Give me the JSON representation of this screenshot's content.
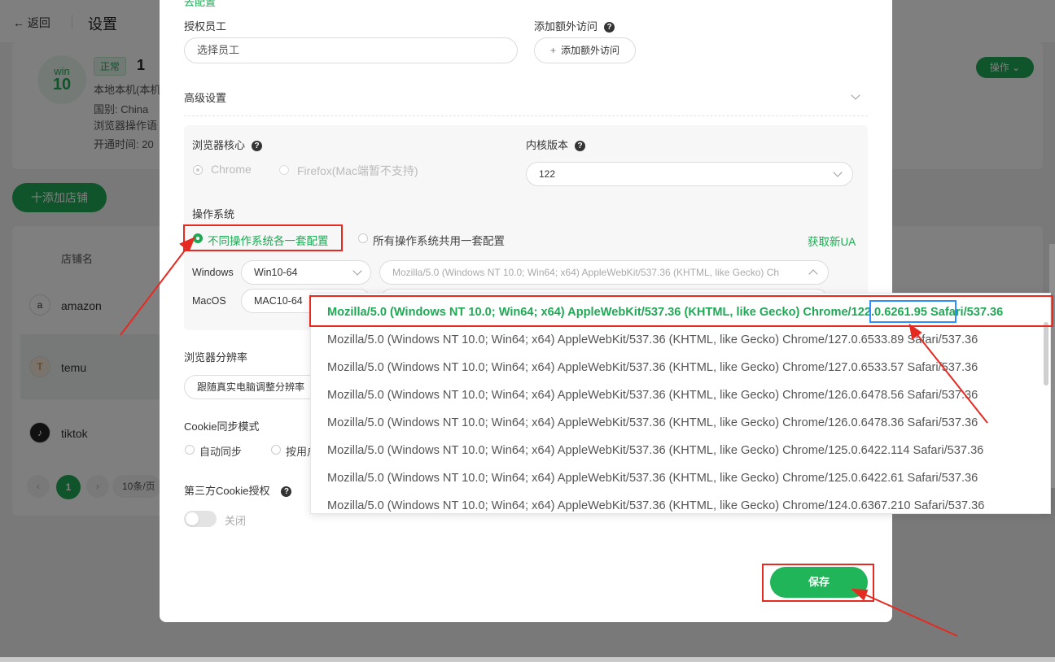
{
  "background": {
    "back_label": "返回",
    "page_title": "设置",
    "avatar_line1": "win",
    "avatar_line2": "10",
    "status_badge": "正常",
    "account_num": "1",
    "info_lines": [
      "本地本机(本机",
      "国别: China",
      "浏览器操作语",
      "开通时间: 20"
    ],
    "operate_button": "操作",
    "add_shop_button": "十添加店铺",
    "table_header_shop": "店铺名",
    "shops": [
      {
        "name": "amazon",
        "icon": "a"
      },
      {
        "name": "temu",
        "icon": "T"
      },
      {
        "name": "tiktok",
        "icon": "♪"
      }
    ],
    "pager_current": "1",
    "pager_size": "10条/页"
  },
  "modal": {
    "top_hint": "去配置",
    "auth_staff_label": "授权员工",
    "auth_staff_placeholder": "选择员工",
    "extra_access_label": "添加额外访问",
    "extra_access_button": "添加额外访问",
    "advanced_label": "高级设置",
    "browser_core_label": "浏览器核心",
    "core_chrome": "Chrome",
    "core_firefox": "Firefox(Mac端暂不支持)",
    "kernel_version_label": "内核版本",
    "kernel_version_value": "122",
    "os_label": "操作系统",
    "os_option_each": "不同操作系统各一套配置",
    "os_option_shared": "所有操作系统共用一套配置",
    "get_new_ua": "获取新UA",
    "windows_label": "Windows",
    "windows_value": "Win10-64",
    "windows_ua": "Mozilla/5.0 (Windows NT 10.0; Win64; x64) AppleWebKit/537.36 (KHTML, like Gecko) Ch",
    "macos_label": "MacOS",
    "macos_value": "MAC10-64",
    "resolution_label": "浏览器分辨率",
    "resolution_value": "跟随真实电脑调整分辨率",
    "cookie_sync_label": "Cookie同步模式",
    "cookie_auto": "自动同步",
    "cookie_manual": "按用户",
    "third_cookie_label": "第三方Cookie授权",
    "toggle_label": "关闭",
    "save_button": "保存"
  },
  "dropdown": {
    "selected_prefix": "Mozilla/5.0 (Windows NT 10.0; Win64; x64) AppleWebKit/537.36 (KHTML, like Gecko) Chrome/",
    "selected_version": "122.0.6261.95",
    "selected_suffix": " Safari/537.36",
    "items": [
      "Mozilla/5.0 (Windows NT 10.0; Win64; x64) AppleWebKit/537.36 (KHTML, like Gecko) Chrome/127.0.6533.89 Safari/537.36",
      "Mozilla/5.0 (Windows NT 10.0; Win64; x64) AppleWebKit/537.36 (KHTML, like Gecko) Chrome/127.0.6533.57 Safari/537.36",
      "Mozilla/5.0 (Windows NT 10.0; Win64; x64) AppleWebKit/537.36 (KHTML, like Gecko) Chrome/126.0.6478.56 Safari/537.36",
      "Mozilla/5.0 (Windows NT 10.0; Win64; x64) AppleWebKit/537.36 (KHTML, like Gecko) Chrome/126.0.6478.36 Safari/537.36",
      "Mozilla/5.0 (Windows NT 10.0; Win64; x64) AppleWebKit/537.36 (KHTML, like Gecko) Chrome/125.0.6422.114 Safari/537.36",
      "Mozilla/5.0 (Windows NT 10.0; Win64; x64) AppleWebKit/537.36 (KHTML, like Gecko) Chrome/125.0.6422.61 Safari/537.36",
      "Mozilla/5.0 (Windows NT 10.0; Win64; x64) AppleWebKit/537.36 (KHTML, like Gecko) Chrome/124.0.6367.210 Safari/537.36"
    ]
  },
  "colors": {
    "accent": "#1fa955",
    "annotation_red": "#e52a22",
    "annotation_blue": "#2e90ff"
  }
}
